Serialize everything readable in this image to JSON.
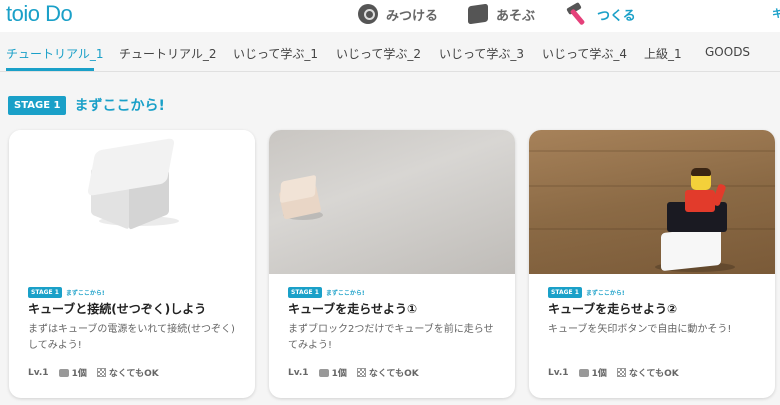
{
  "app": {
    "logo": "toio Do",
    "right_fragment": "キ"
  },
  "topnav": [
    {
      "label": "みつける",
      "icon": "discover-icon",
      "active": false
    },
    {
      "label": "あそぶ",
      "icon": "play-cube-icon",
      "active": false
    },
    {
      "label": "つくる",
      "icon": "hammer-icon",
      "active": true
    }
  ],
  "tabs": [
    {
      "label": "チュートリアル_1",
      "active": true
    },
    {
      "label": "チュートリアル_2"
    },
    {
      "label": "いじって学ぶ_1"
    },
    {
      "label": "いじって学ぶ_2"
    },
    {
      "label": "いじって学ぶ_3"
    },
    {
      "label": "いじって学ぶ_4"
    },
    {
      "label": "上級_1"
    },
    {
      "label": "GOODS"
    }
  ],
  "stage": {
    "badge": "STAGE 1",
    "title": "まずここから!"
  },
  "cards": [
    {
      "badge": "STAGE 1",
      "stage_title": "まずここから!",
      "title": "キューブと接続(せつぞく)しよう",
      "desc": "まずはキューブの電源をいれて接続(せつぞく)してみよう!",
      "level": "Lv.1",
      "count": "1個",
      "mat": "なくてもOK"
    },
    {
      "badge": "STAGE 1",
      "stage_title": "まずここから!",
      "title": "キューブを走らせよう①",
      "desc": "まずブロック2つだけでキューブを前に走らせてみよう!",
      "level": "Lv.1",
      "count": "1個",
      "mat": "なくてもOK"
    },
    {
      "badge": "STAGE 1",
      "stage_title": "まずここから!",
      "title": "キューブを走らせよう②",
      "desc": "キューブを矢印ボタンで自由に動かそう!",
      "level": "Lv.1",
      "count": "1個",
      "mat": "なくてもOK"
    }
  ]
}
